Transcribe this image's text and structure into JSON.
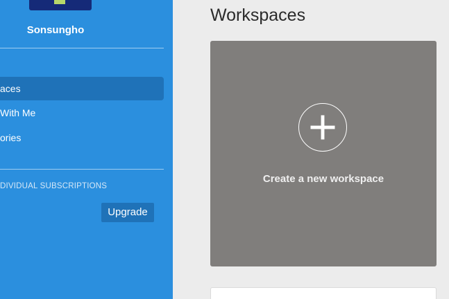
{
  "sidebar": {
    "username": "Sonsungho",
    "nav_items": [
      {
        "label": "aces"
      },
      {
        "label": "With Me"
      },
      {
        "label": "ories"
      }
    ],
    "section_label": "DIVIDUAL SUBSCRIPTIONS",
    "upgrade_label": "Upgrade"
  },
  "main": {
    "title": "Workspaces",
    "create_card": {
      "label": "Create a new workspace",
      "icon": "plus-circle-icon"
    }
  },
  "colors": {
    "sidebar_bg": "#2b8fde",
    "sidebar_active": "#1f72b8",
    "card_bg": "#807e7c",
    "page_bg": "#ececec"
  }
}
